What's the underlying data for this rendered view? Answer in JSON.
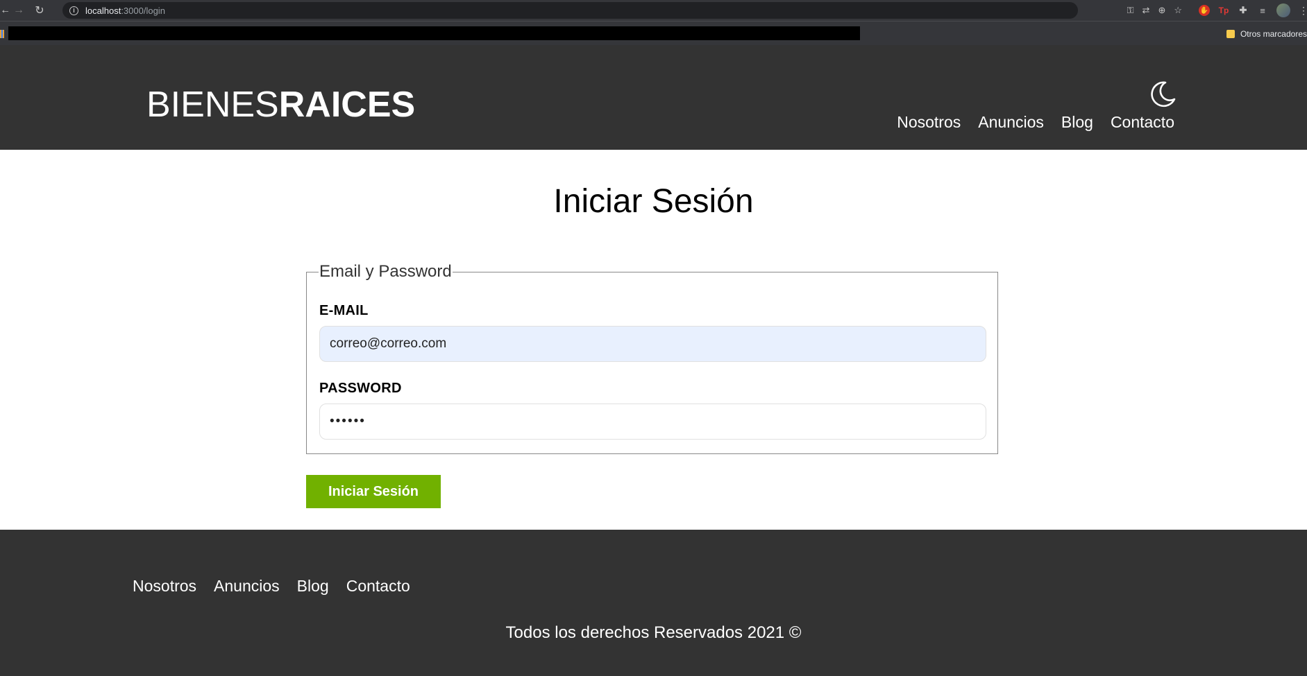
{
  "browser": {
    "url_host": "localhost",
    "url_path": ":3000/login",
    "bookmarks_folder": "Otros marcadores"
  },
  "header": {
    "logo_light": "BIENES",
    "logo_bold": "RAICES",
    "nav": [
      "Nosotros",
      "Anuncios",
      "Blog",
      "Contacto"
    ]
  },
  "main": {
    "title": "Iniciar Sesión",
    "fieldset_legend": "Email y Password",
    "email_label": "E-MAIL",
    "email_value": "correo@correo.com",
    "password_label": "PASSWORD",
    "password_value": "••••••",
    "submit_label": "Iniciar Sesión"
  },
  "footer": {
    "nav": [
      "Nosotros",
      "Anuncios",
      "Blog",
      "Contacto"
    ],
    "copyright": "Todos los derechos Reservados 2021 ©"
  },
  "colors": {
    "header_bg": "#333333",
    "accent_green": "#71b100",
    "autofill_bg": "#e8f0fe"
  },
  "icons": {
    "theme_toggle": "moon-icon"
  }
}
